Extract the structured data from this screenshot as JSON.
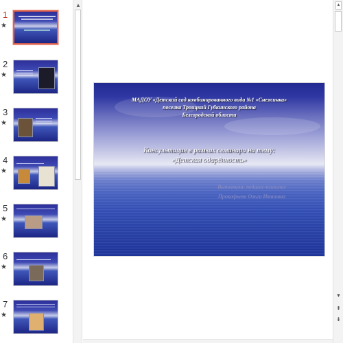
{
  "thumbnails": [
    {
      "number": "1",
      "animation_icon": "★",
      "selected": true
    },
    {
      "number": "2",
      "animation_icon": "★",
      "selected": false
    },
    {
      "number": "3",
      "animation_icon": "★",
      "selected": false
    },
    {
      "number": "4",
      "animation_icon": "★",
      "selected": false
    },
    {
      "number": "5",
      "animation_icon": "★",
      "selected": false
    },
    {
      "number": "6",
      "animation_icon": "★",
      "selected": false
    },
    {
      "number": "7",
      "animation_icon": "★",
      "selected": false
    }
  ],
  "slide": {
    "org_line1": "МАДОУ «Детский сад комбинированного вида №1 «Снежинка»",
    "org_line2": "поселка Троицкий Губкинского района",
    "org_line3": "Белгородской области",
    "topic_line1": "Консультация в рамках семинара на тему:",
    "topic_line2": "«Детская одарённость»",
    "author_line1": "Выполнила: педагог-психолог",
    "author_line2": "Прокофьева Ольга Ивановна"
  },
  "icons": {
    "scroll_up": "▲",
    "scroll_down": "▼",
    "prev_slide": "⇞",
    "next_slide": "⇟"
  },
  "colors": {
    "selected_border": "#e0604a",
    "active_number": "#c0392b"
  }
}
